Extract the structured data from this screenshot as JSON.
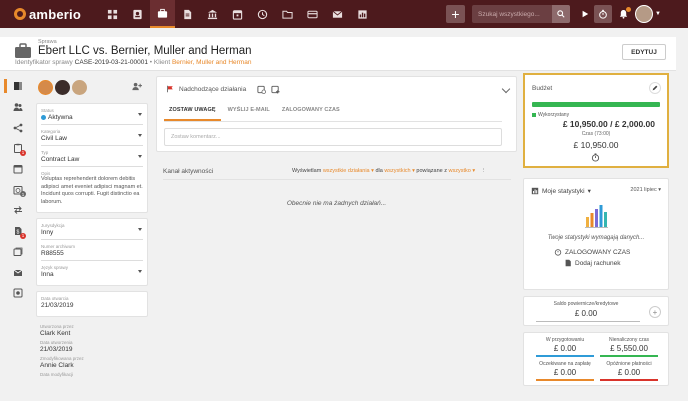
{
  "app": {
    "brand": "amberio"
  },
  "topbar": {
    "search_placeholder": "Szukaj wszystkiego...",
    "nav_icons": [
      "dashboard-icon",
      "contacts-icon",
      "briefcase-icon",
      "document-icon",
      "bank-icon",
      "calendar-icon",
      "clock-icon",
      "folder-icon",
      "card-icon",
      "mail-icon",
      "reports-icon"
    ]
  },
  "header": {
    "type_label": "Sprawa",
    "title": "Ebert LLC vs. Bernier, Muller and Herman",
    "id_label": "Identyfikator sprawy",
    "id_value": "CASE-2019-03-21-00001",
    "separator": "•",
    "client_label": "Klient",
    "client_value": "Bernier, Muller and Herman",
    "edit_label": "EDYTUJ"
  },
  "rail": {
    "items": [
      {
        "icon": "summary-icon",
        "badge": ""
      },
      {
        "icon": "people-icon",
        "badge": ""
      },
      {
        "icon": "share-icon",
        "badge": ""
      },
      {
        "icon": "tasks-icon",
        "badge": "1"
      },
      {
        "icon": "calendar-icon",
        "badge": ""
      },
      {
        "icon": "clock-icon",
        "badge": "1"
      },
      {
        "icon": "transfer-icon",
        "badge": ""
      },
      {
        "icon": "finance-icon",
        "badge": "1"
      },
      {
        "icon": "documents-icon",
        "badge": ""
      },
      {
        "icon": "mail-icon",
        "badge": ""
      },
      {
        "icon": "settings-icon",
        "badge": ""
      }
    ],
    "colors": {
      "badge_red": "#d9342b",
      "badge_gray": "#666666"
    }
  },
  "props": {
    "status": {
      "label": "Status",
      "value": "Aktywna"
    },
    "category": {
      "label": "Kategoria",
      "value": "Civil Law"
    },
    "type": {
      "label": "Typ",
      "value": "Contract Law"
    },
    "description": {
      "label": "Opis",
      "value": "Voluptas reprehenderit dolorem debitis adipisci amet eveniet adipisci magnam et. Incidunt quos corrupti. Fugit distinctio ea laborum."
    },
    "jurisdiction": {
      "label": "Jurysdykcja",
      "value": "Inny"
    },
    "archive_number": {
      "label": "Numer archiwum",
      "value": "R88555"
    },
    "language": {
      "label": "Język sprawy",
      "value": "Inna"
    },
    "opened": {
      "label": "Data otwarcia",
      "value": "21/03/2019"
    },
    "created_by": {
      "label": "Utworzona przez",
      "value": "Clark Kent"
    },
    "created_at": {
      "label": "Data utworzenia",
      "value": "21/03/2019"
    },
    "modified_by": {
      "label": "Zmodyfikowana przez",
      "value": "Annie Clark"
    },
    "modified_at": {
      "label": "Data modyfikacji",
      "value": ""
    }
  },
  "center": {
    "alerts_label": "Nadchodzące działania",
    "tabs": [
      "ZOSTAW UWAGĘ",
      "WYŚLIJ E-MAIL",
      "ZALOGOWANY CZAS"
    ],
    "comment_placeholder": "Zostaw komentarz...",
    "activity_title": "Kanał aktywności",
    "filter": {
      "show": "Wyświetlam",
      "what": "wszystkie działania",
      "for": "dla",
      "who": "wszystkich",
      "related": "powiązane z",
      "to": "wszystko"
    },
    "empty_text": "Obecnie nie ma żadnych działań..."
  },
  "budget": {
    "title": "Budżet",
    "used_label": "Wykorzystany",
    "used_fraction": 1.0,
    "amount": "£ 10,950.00 / £ 2,000.00",
    "time_label": "Czas (73:00)",
    "total": "£ 10,950.00",
    "colors": {
      "bar": "#35b652",
      "highlight": "#e0b040"
    }
  },
  "stats": {
    "title": "Moje statystyki",
    "period": "2021 lipiec",
    "message": "Twoje statystyki wymagają danych...",
    "logged_time": "ZALOGOWANY CZAS",
    "add_bill": "Dodaj rachunek"
  },
  "balance": {
    "label": "Saldo powiernicze/kredytowe",
    "value": "£ 0.00"
  },
  "amounts": {
    "items": [
      {
        "label": "W przygotowaniu",
        "value": "£ 0.00",
        "color": "#2f9bd7"
      },
      {
        "label": "Nienaliczony czas",
        "value": "£ 5,550.00",
        "color": "#35b652"
      },
      {
        "label": "Oczekiwane na zapłatę",
        "value": "£ 0.00",
        "color": "#e8892b"
      },
      {
        "label": "Opóźnione płatności",
        "value": "£ 0.00",
        "color": "#d9342b"
      }
    ]
  }
}
